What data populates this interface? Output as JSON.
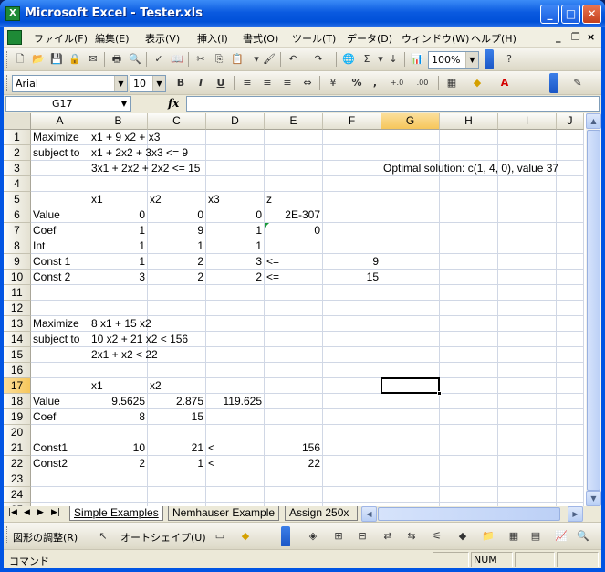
{
  "window": {
    "title": "Microsoft Excel - Tester.xls",
    "minimize_label": "_",
    "maximize_label": "□",
    "close_label": "✕"
  },
  "menubar": {
    "items": [
      "ファイル(F)",
      "編集(E)",
      "表示(V)",
      "挿入(I)",
      "書式(O)",
      "ツール(T)",
      "データ(D)",
      "ウィンドウ(W)",
      "ヘルプ(H)"
    ],
    "doc_minimize": "_",
    "doc_restore": "❐",
    "doc_close": "×"
  },
  "standard_toolbar": {
    "zoom": "100%"
  },
  "formatting_toolbar": {
    "font": "Arial",
    "font_size": "10",
    "bold": "B",
    "italic": "I",
    "underline": "U",
    "percent": "%",
    "comma": ",",
    "inc_decimal": "+.0 .00",
    "dec_decimal": ".00 +.0"
  },
  "formula_bar": {
    "name_box": "G17",
    "fx": "fx",
    "formula": ""
  },
  "columns": [
    "A",
    "B",
    "C",
    "D",
    "E",
    "F",
    "G",
    "H",
    "I",
    "J"
  ],
  "active_column": "G",
  "rows": [
    "1",
    "2",
    "3",
    "4",
    "5",
    "6",
    "7",
    "8",
    "9",
    "10",
    "11",
    "12",
    "13",
    "14",
    "15",
    "16",
    "17",
    "18",
    "19",
    "20",
    "21",
    "22",
    "23",
    "24",
    "25"
  ],
  "active_row": "17",
  "cells": [
    {
      "ref": "A1",
      "value": "Maximize"
    },
    {
      "ref": "B1",
      "value": "x1 + 9 x2 + x3"
    },
    {
      "ref": "A2",
      "value": "subject to"
    },
    {
      "ref": "B2",
      "value": "x1 + 2x2 + 3x3 <= 9"
    },
    {
      "ref": "B3",
      "value": "3x1 + 2x2 + 2x2 <= 15"
    },
    {
      "ref": "G3",
      "value": "Optimal solution: c(1, 4, 0), value 37"
    },
    {
      "ref": "B5",
      "value": "x1"
    },
    {
      "ref": "C5",
      "value": "x2"
    },
    {
      "ref": "D5",
      "value": "x3"
    },
    {
      "ref": "E5",
      "value": "z"
    },
    {
      "ref": "A6",
      "value": "Value"
    },
    {
      "ref": "B6",
      "value": "0",
      "num": true
    },
    {
      "ref": "C6",
      "value": "0",
      "num": true
    },
    {
      "ref": "D6",
      "value": "0",
      "num": true
    },
    {
      "ref": "E6",
      "value": "2E-307",
      "num": true
    },
    {
      "ref": "A7",
      "value": "Coef"
    },
    {
      "ref": "B7",
      "value": "1",
      "num": true
    },
    {
      "ref": "C7",
      "value": "9",
      "num": true
    },
    {
      "ref": "D7",
      "value": "1",
      "num": true
    },
    {
      "ref": "E7",
      "value": "0",
      "num": true
    },
    {
      "ref": "A8",
      "value": "Int"
    },
    {
      "ref": "B8",
      "value": "1",
      "num": true
    },
    {
      "ref": "C8",
      "value": "1",
      "num": true
    },
    {
      "ref": "D8",
      "value": "1",
      "num": true
    },
    {
      "ref": "A9",
      "value": "Const 1"
    },
    {
      "ref": "B9",
      "value": "1",
      "num": true
    },
    {
      "ref": "C9",
      "value": "2",
      "num": true
    },
    {
      "ref": "D9",
      "value": "3",
      "num": true
    },
    {
      "ref": "E9",
      "value": "<="
    },
    {
      "ref": "F9",
      "value": "9",
      "num": true
    },
    {
      "ref": "A10",
      "value": "Const 2"
    },
    {
      "ref": "B10",
      "value": "3",
      "num": true
    },
    {
      "ref": "C10",
      "value": "2",
      "num": true
    },
    {
      "ref": "D10",
      "value": "2",
      "num": true
    },
    {
      "ref": "E10",
      "value": "<="
    },
    {
      "ref": "F10",
      "value": "15",
      "num": true
    },
    {
      "ref": "A13",
      "value": "Maximize"
    },
    {
      "ref": "B13",
      "value": "8 x1 + 15 x2"
    },
    {
      "ref": "A14",
      "value": "subject to"
    },
    {
      "ref": "B14",
      "value": "10 x2 + 21 x2 < 156"
    },
    {
      "ref": "B15",
      "value": "2x1 + x2 < 22"
    },
    {
      "ref": "B17",
      "value": "x1"
    },
    {
      "ref": "C17",
      "value": "x2"
    },
    {
      "ref": "A18",
      "value": "Value"
    },
    {
      "ref": "B18",
      "value": "9.5625",
      "num": true
    },
    {
      "ref": "C18",
      "value": "2.875",
      "num": true
    },
    {
      "ref": "D18",
      "value": "119.625",
      "num": true
    },
    {
      "ref": "A19",
      "value": "Coef"
    },
    {
      "ref": "B19",
      "value": "8",
      "num": true
    },
    {
      "ref": "C19",
      "value": "15",
      "num": true
    },
    {
      "ref": "A21",
      "value": "Const1"
    },
    {
      "ref": "B21",
      "value": "10",
      "num": true
    },
    {
      "ref": "C21",
      "value": "21",
      "num": true
    },
    {
      "ref": "D21",
      "value": "<"
    },
    {
      "ref": "E21",
      "value": "156",
      "num": true
    },
    {
      "ref": "A22",
      "value": "Const2"
    },
    {
      "ref": "B22",
      "value": "2",
      "num": true
    },
    {
      "ref": "C22",
      "value": "1",
      "num": true
    },
    {
      "ref": "D22",
      "value": "<"
    },
    {
      "ref": "E22",
      "value": "22",
      "num": true
    }
  ],
  "sheet_tabs": [
    "Simple Examples",
    "Nemhauser Example",
    "Assign 250x"
  ],
  "active_sheet": "Simple Examples",
  "drawing_toolbar": {
    "draw_label": "図形の調整(R)",
    "autoshape_label": "オートシェイプ(U)"
  },
  "status": {
    "mode": "コマンド",
    "num": "NUM"
  },
  "colors": {
    "title_bar": "#0a5ae0",
    "active_header": "#f6c65a",
    "comment_indicator": "#1a9a3c",
    "gridline": "#d0d7e5"
  }
}
